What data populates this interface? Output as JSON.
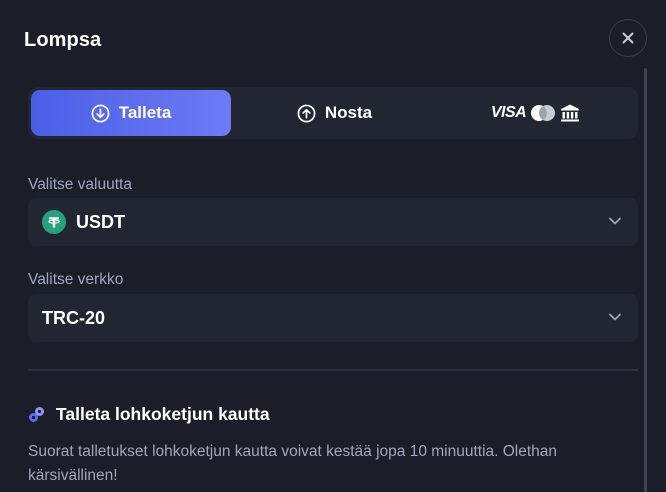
{
  "header": {
    "title": "Lompsa",
    "close_icon": "close-icon"
  },
  "tabs": [
    {
      "label": "Talleta",
      "icon": "arrow-down-circle-icon",
      "active": true
    },
    {
      "label": "Nosta",
      "icon": "arrow-up-circle-icon",
      "active": false
    },
    {
      "label": "VISA",
      "icons": [
        "mastercard-icon",
        "bank-icon"
      ],
      "active": false
    }
  ],
  "currency": {
    "label": "Valitse valuutta",
    "value": "USDT",
    "icon": "tether-icon"
  },
  "network": {
    "label": "Valitse verkko",
    "value": "TRC-20"
  },
  "info": {
    "title": "Talleta lohkoketjun kautta",
    "icon": "blockchain-icon",
    "text": "Suorat talletukset lohkoketjun kautta voivat kestää jopa 10 minuuttia. Olethan kärsivällinen!"
  },
  "colors": {
    "background": "#1b1e29",
    "panel": "#222633",
    "accent_start": "#4c5ee6",
    "accent_end": "#6c7bf5",
    "muted_text": "#a0a6ba",
    "tether": "#26a17b"
  }
}
